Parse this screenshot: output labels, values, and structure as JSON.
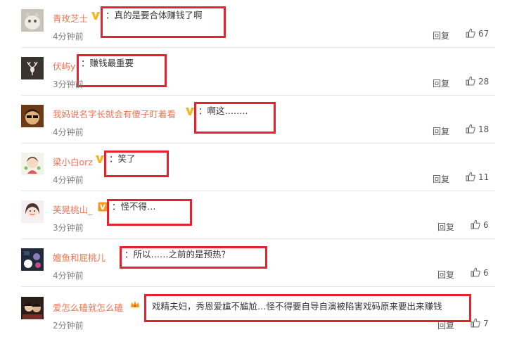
{
  "comments": [
    {
      "username": "青玫芝士",
      "text": "：真的是要合体赚钱了啊",
      "time": "4分钟前",
      "reply": "回复",
      "likes": "67"
    },
    {
      "username": "伏屿y",
      "text": "：赚钱最重要",
      "time": "3分钟前",
      "reply": "回复",
      "likes": "28"
    },
    {
      "username": "我妈说名字长就会有傻子盯着看",
      "text": "：啊这……..",
      "time": "4分钟前",
      "reply": "回复",
      "likes": "18"
    },
    {
      "username": "梁小白orz",
      "text": "：笑了",
      "time": "4分钟前",
      "reply": "回复",
      "likes": "11"
    },
    {
      "username": "芙晃桃山_",
      "text": "：怪不得…",
      "time": "3分钟前",
      "reply": "回复",
      "likes": "6"
    },
    {
      "username": "嬗鱼和屁桃儿",
      "text": "：所以……之前的是预热？",
      "time": "4分钟前",
      "reply": "回复",
      "likes": "6"
    },
    {
      "username": "爱怎么磕就怎么磕",
      "text": "戏精夫妇，秀恩爱尴不尴尬…怪不得要自导自演被陷害戏码原来要出来赚钱",
      "time": "2分钟前",
      "reply": "回复",
      "likes": "7"
    }
  ],
  "colors": {
    "username": "#eb7350",
    "highlight": "#e8212e",
    "vip_badge": "#f6b51e",
    "crown_badge": "#f29a1b"
  }
}
